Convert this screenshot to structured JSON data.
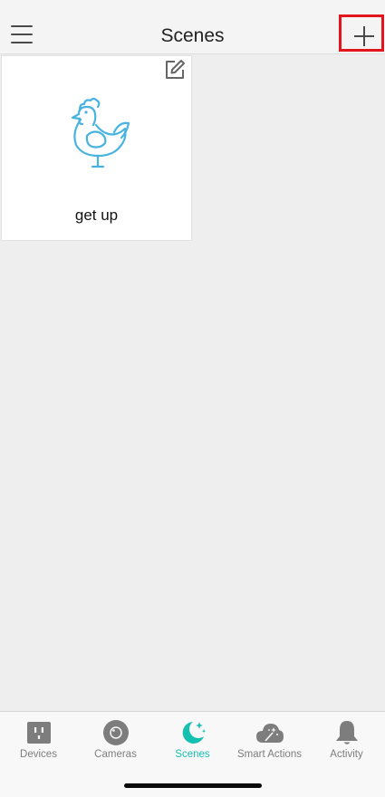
{
  "header": {
    "title": "Scenes",
    "menu_icon": "hamburger-menu-icon",
    "add_icon": "plus-icon",
    "highlight_color": "#e3141b"
  },
  "scenes": [
    {
      "label": "get up",
      "icon": "rooster-icon",
      "edit_icon": "edit-pencil-icon"
    }
  ],
  "tabs": [
    {
      "label": "Devices",
      "icon": "plug-outlet-icon",
      "active": false
    },
    {
      "label": "Cameras",
      "icon": "camera-lens-icon",
      "active": false
    },
    {
      "label": "Scenes",
      "icon": "moon-stars-icon",
      "active": true
    },
    {
      "label": "Smart Actions",
      "icon": "cloud-magic-wand-icon",
      "active": false
    },
    {
      "label": "Activity",
      "icon": "bell-icon",
      "active": false
    }
  ],
  "colors": {
    "accent": "#16c0b1",
    "inactive_tab": "#7d7d7d",
    "illustration": "#49b3e0",
    "background": "#eeeeee"
  }
}
